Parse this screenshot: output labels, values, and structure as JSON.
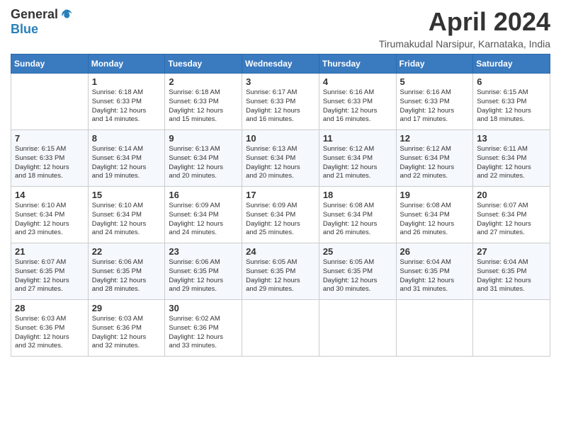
{
  "header": {
    "logo_general": "General",
    "logo_blue": "Blue",
    "month_title": "April 2024",
    "location": "Tirumakudal Narsipur, Karnataka, India"
  },
  "days_of_week": [
    "Sunday",
    "Monday",
    "Tuesday",
    "Wednesday",
    "Thursday",
    "Friday",
    "Saturday"
  ],
  "weeks": [
    [
      null,
      {
        "date": "1",
        "sunrise": "6:18 AM",
        "sunset": "6:33 PM",
        "daylight": "12 hours and 14 minutes."
      },
      {
        "date": "2",
        "sunrise": "6:18 AM",
        "sunset": "6:33 PM",
        "daylight": "12 hours and 15 minutes."
      },
      {
        "date": "3",
        "sunrise": "6:17 AM",
        "sunset": "6:33 PM",
        "daylight": "12 hours and 16 minutes."
      },
      {
        "date": "4",
        "sunrise": "6:16 AM",
        "sunset": "6:33 PM",
        "daylight": "12 hours and 16 minutes."
      },
      {
        "date": "5",
        "sunrise": "6:16 AM",
        "sunset": "6:33 PM",
        "daylight": "12 hours and 17 minutes."
      },
      {
        "date": "6",
        "sunrise": "6:15 AM",
        "sunset": "6:33 PM",
        "daylight": "12 hours and 18 minutes."
      }
    ],
    [
      {
        "date": "7",
        "sunrise": "6:15 AM",
        "sunset": "6:33 PM",
        "daylight": "12 hours and 18 minutes."
      },
      {
        "date": "8",
        "sunrise": "6:14 AM",
        "sunset": "6:34 PM",
        "daylight": "12 hours and 19 minutes."
      },
      {
        "date": "9",
        "sunrise": "6:13 AM",
        "sunset": "6:34 PM",
        "daylight": "12 hours and 20 minutes."
      },
      {
        "date": "10",
        "sunrise": "6:13 AM",
        "sunset": "6:34 PM",
        "daylight": "12 hours and 20 minutes."
      },
      {
        "date": "11",
        "sunrise": "6:12 AM",
        "sunset": "6:34 PM",
        "daylight": "12 hours and 21 minutes."
      },
      {
        "date": "12",
        "sunrise": "6:12 AM",
        "sunset": "6:34 PM",
        "daylight": "12 hours and 22 minutes."
      },
      {
        "date": "13",
        "sunrise": "6:11 AM",
        "sunset": "6:34 PM",
        "daylight": "12 hours and 22 minutes."
      }
    ],
    [
      {
        "date": "14",
        "sunrise": "6:10 AM",
        "sunset": "6:34 PM",
        "daylight": "12 hours and 23 minutes."
      },
      {
        "date": "15",
        "sunrise": "6:10 AM",
        "sunset": "6:34 PM",
        "daylight": "12 hours and 24 minutes."
      },
      {
        "date": "16",
        "sunrise": "6:09 AM",
        "sunset": "6:34 PM",
        "daylight": "12 hours and 24 minutes."
      },
      {
        "date": "17",
        "sunrise": "6:09 AM",
        "sunset": "6:34 PM",
        "daylight": "12 hours and 25 minutes."
      },
      {
        "date": "18",
        "sunrise": "6:08 AM",
        "sunset": "6:34 PM",
        "daylight": "12 hours and 26 minutes."
      },
      {
        "date": "19",
        "sunrise": "6:08 AM",
        "sunset": "6:34 PM",
        "daylight": "12 hours and 26 minutes."
      },
      {
        "date": "20",
        "sunrise": "6:07 AM",
        "sunset": "6:34 PM",
        "daylight": "12 hours and 27 minutes."
      }
    ],
    [
      {
        "date": "21",
        "sunrise": "6:07 AM",
        "sunset": "6:35 PM",
        "daylight": "12 hours and 27 minutes."
      },
      {
        "date": "22",
        "sunrise": "6:06 AM",
        "sunset": "6:35 PM",
        "daylight": "12 hours and 28 minutes."
      },
      {
        "date": "23",
        "sunrise": "6:06 AM",
        "sunset": "6:35 PM",
        "daylight": "12 hours and 29 minutes."
      },
      {
        "date": "24",
        "sunrise": "6:05 AM",
        "sunset": "6:35 PM",
        "daylight": "12 hours and 29 minutes."
      },
      {
        "date": "25",
        "sunrise": "6:05 AM",
        "sunset": "6:35 PM",
        "daylight": "12 hours and 30 minutes."
      },
      {
        "date": "26",
        "sunrise": "6:04 AM",
        "sunset": "6:35 PM",
        "daylight": "12 hours and 31 minutes."
      },
      {
        "date": "27",
        "sunrise": "6:04 AM",
        "sunset": "6:35 PM",
        "daylight": "12 hours and 31 minutes."
      }
    ],
    [
      {
        "date": "28",
        "sunrise": "6:03 AM",
        "sunset": "6:36 PM",
        "daylight": "12 hours and 32 minutes."
      },
      {
        "date": "29",
        "sunrise": "6:03 AM",
        "sunset": "6:36 PM",
        "daylight": "12 hours and 32 minutes."
      },
      {
        "date": "30",
        "sunrise": "6:02 AM",
        "sunset": "6:36 PM",
        "daylight": "12 hours and 33 minutes."
      },
      null,
      null,
      null,
      null
    ]
  ],
  "labels": {
    "sunrise_prefix": "Sunrise: ",
    "sunset_prefix": "Sunset: ",
    "daylight_prefix": "Daylight: "
  }
}
